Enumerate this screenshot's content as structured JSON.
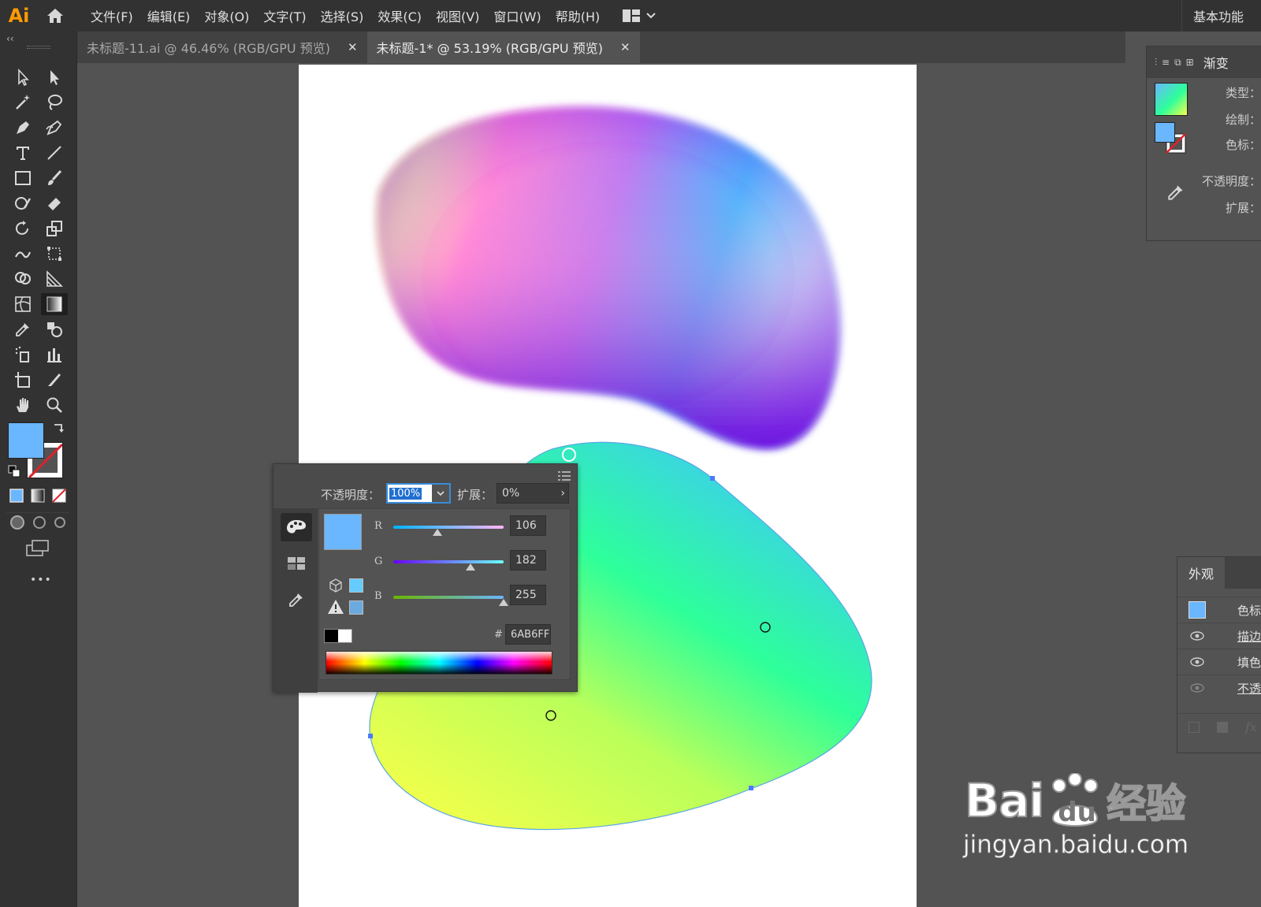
{
  "app": {
    "logo": "Ai"
  },
  "menu": [
    "文件(F)",
    "编辑(E)",
    "对象(O)",
    "文字(T)",
    "选择(S)",
    "效果(C)",
    "视图(V)",
    "窗口(W)",
    "帮助(H)"
  ],
  "workspace": {
    "label": "基本功能"
  },
  "tabs": [
    {
      "label": "未标题-11.ai @ 46.46% (RGB/GPU 预览)",
      "active": false
    },
    {
      "label": "未标题-1* @ 53.19% (RGB/GPU 预览)",
      "active": true
    }
  ],
  "toolbar": {
    "collapse_label": "‹‹",
    "fill_color": "#6AB6FF",
    "more_label": "•••"
  },
  "gradient_panel": {
    "title": "渐变",
    "rows": [
      "类型：",
      "绘制：",
      "色标：",
      "不透明度：",
      "扩展："
    ]
  },
  "appearance_panel": {
    "title": "外观",
    "rows": [
      "色标",
      "描边",
      "填色",
      "不透明度"
    ]
  },
  "color_popup": {
    "opacity_label": "不透明度：",
    "opacity_value": "100%",
    "expand_label": "扩展：",
    "expand_value": "0%",
    "r_label": "R",
    "r_value": "106",
    "g_label": "G",
    "g_value": "182",
    "b_label": "B",
    "b_value": "255",
    "hex_label": "#",
    "hex_value": "6AB6FF",
    "swatch_color": "#6AB6FF"
  },
  "watermark": {
    "logo": "Bai",
    "logo_du": "du",
    "brand": "经验",
    "url": "jingyan.baidu.com"
  }
}
